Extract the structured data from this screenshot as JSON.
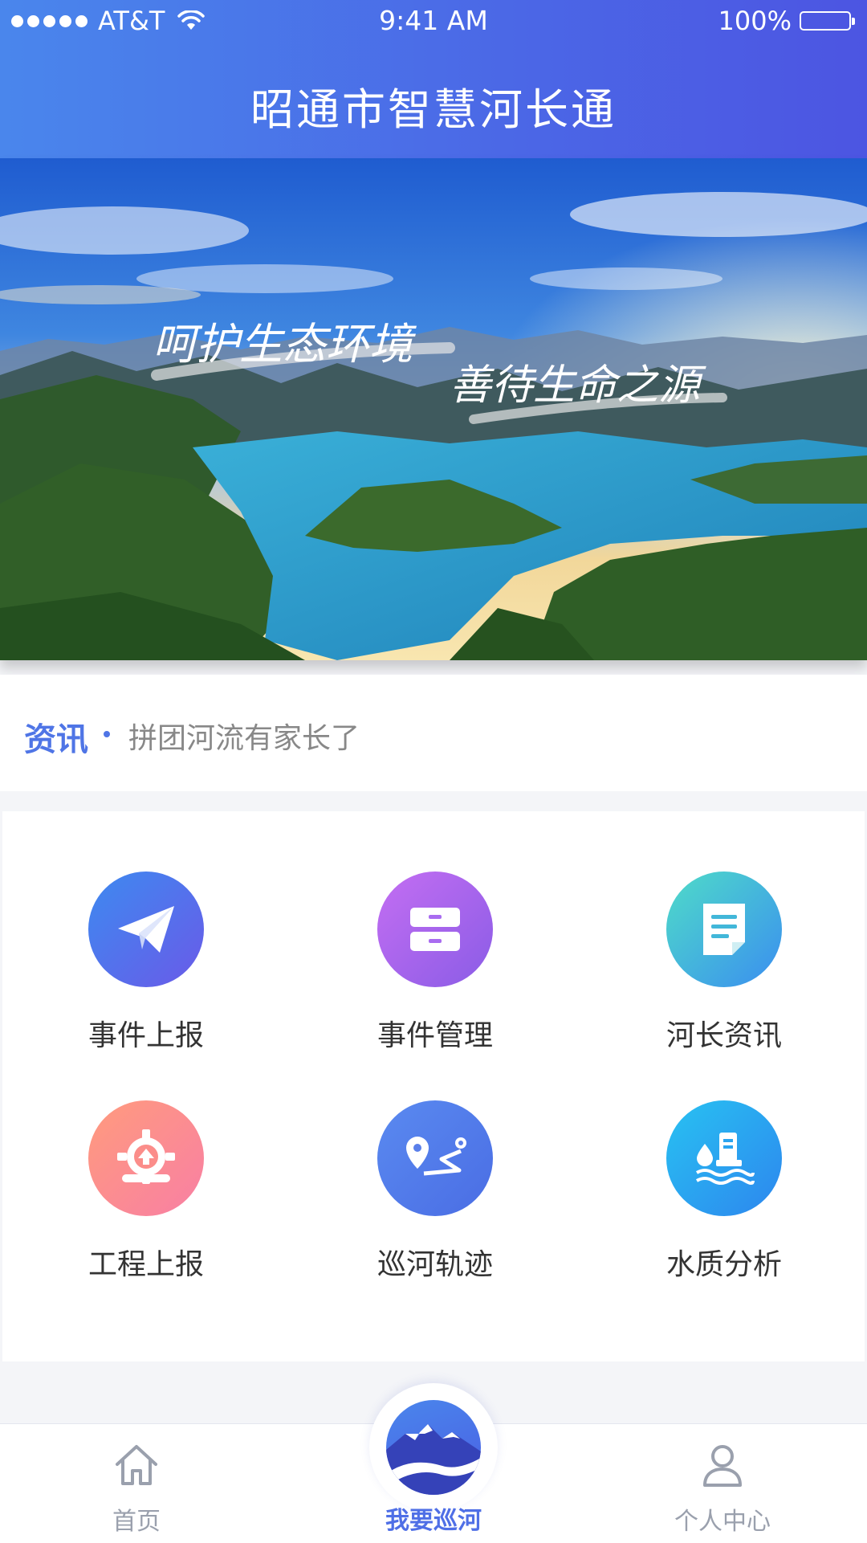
{
  "status_bar": {
    "carrier": "AT&T",
    "time": "9:41 AM",
    "battery": "100%"
  },
  "header": {
    "title": "昭通市智慧河长通"
  },
  "banner": {
    "calligraphy_line1": "呵护生态环境",
    "calligraphy_line2": "善待生命之源"
  },
  "news": {
    "label": "资讯",
    "headline": "拼团河流有家长了"
  },
  "menu": [
    {
      "label": "事件上报",
      "icon": "paper-plane-icon",
      "color": "#4f6ee8"
    },
    {
      "label": "事件管理",
      "icon": "drawer-icon",
      "color": "#a96cf0"
    },
    {
      "label": "河长资讯",
      "icon": "document-icon",
      "color": "#3fc6d6"
    },
    {
      "label": "工程上报",
      "icon": "gear-upload-icon",
      "color": "#fb8d8a"
    },
    {
      "label": "巡河轨迹",
      "icon": "route-pin-icon",
      "color": "#4f7de8"
    },
    {
      "label": "水质分析",
      "icon": "water-quality-icon",
      "color": "#2aa4f0"
    }
  ],
  "tabbar": {
    "home": "首页",
    "patrol": "我要巡河",
    "profile": "个人中心"
  },
  "colors": {
    "accent": "#4f6ee8",
    "inactive": "#9aa0ad"
  }
}
